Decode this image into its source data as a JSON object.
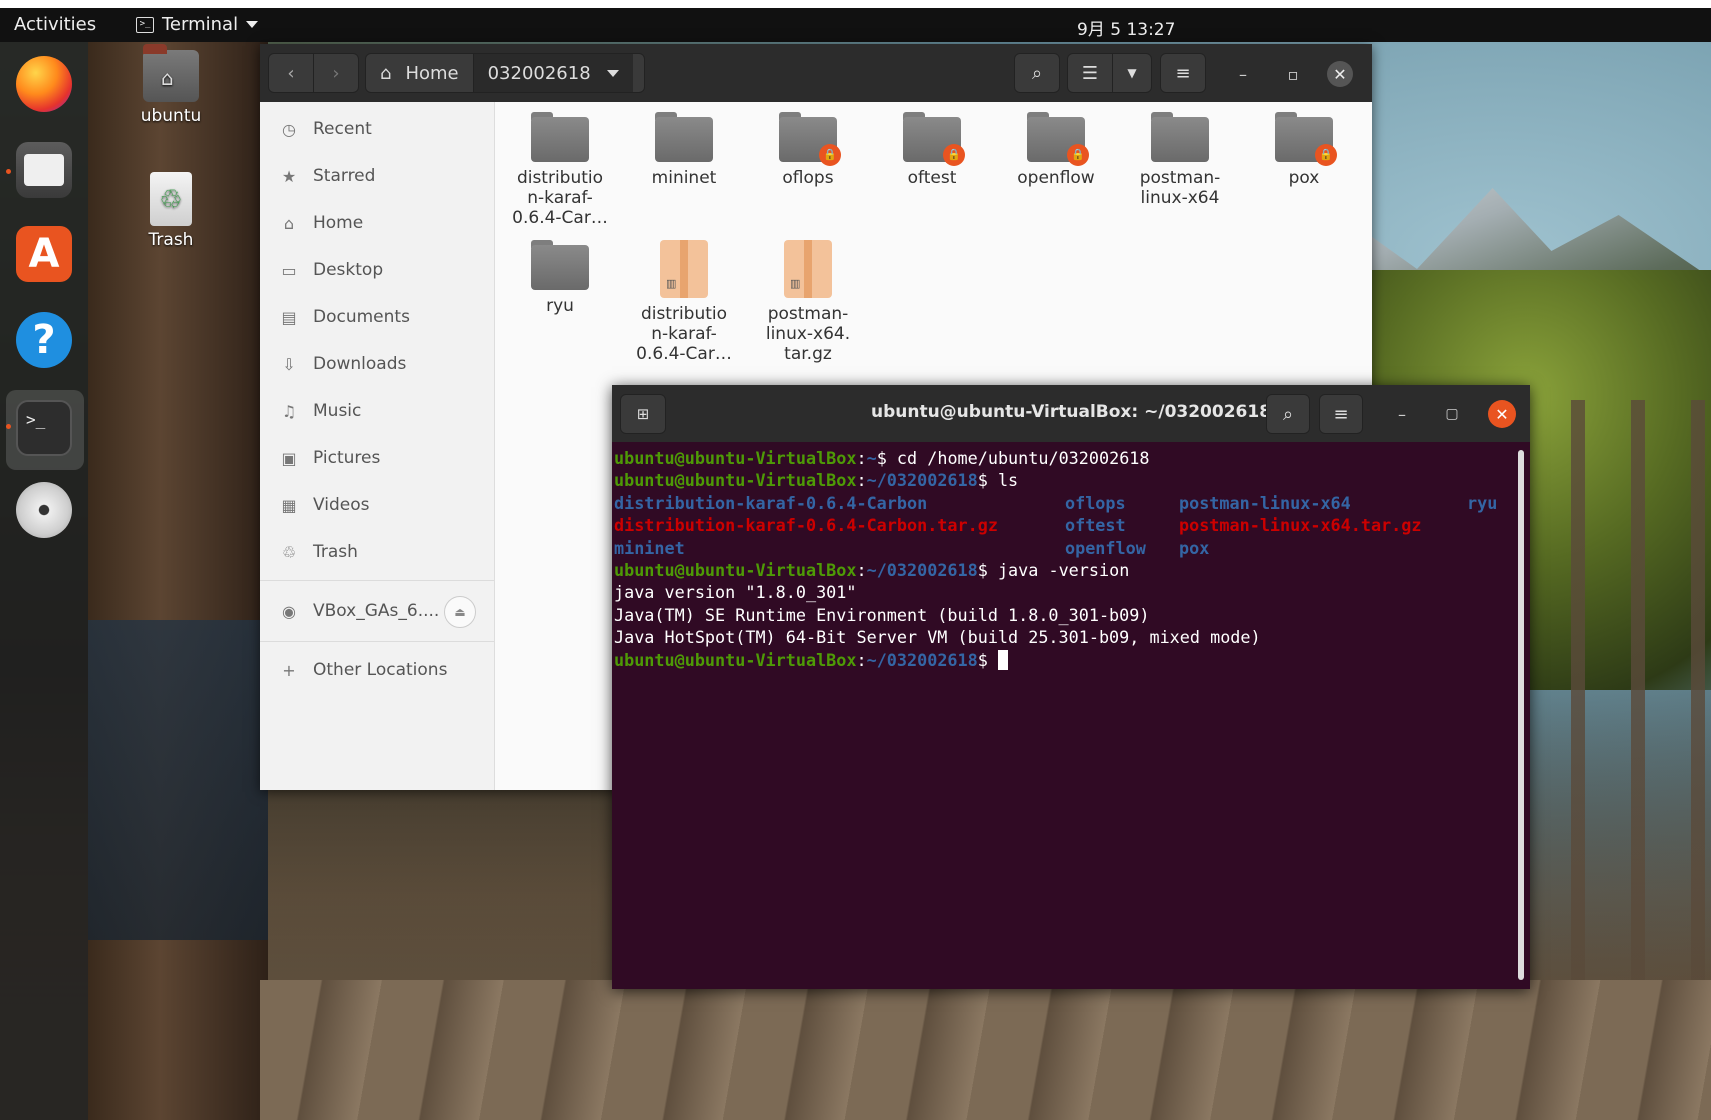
{
  "topbar": {
    "activities": "Activities",
    "app_menu": "Terminal",
    "clock": "9月 5 13:27"
  },
  "dock": {
    "items": [
      "firefox-icon",
      "files-icon",
      "software-icon",
      "help-icon",
      "terminal-icon",
      "disc-icon"
    ],
    "terminal_glyph": ">_",
    "software_glyph": "A",
    "help_glyph": "?"
  },
  "desktop": {
    "home_label": "ubuntu",
    "trash_label": "Trash"
  },
  "files": {
    "nav_back": "‹",
    "nav_forward": "›",
    "path": [
      "Home",
      "032002618"
    ],
    "sidebar": [
      {
        "icon": "clock-icon",
        "glyph": "◷",
        "label": "Recent"
      },
      {
        "icon": "star-icon",
        "glyph": "★",
        "label": "Starred"
      },
      {
        "icon": "home-icon",
        "glyph": "⌂",
        "label": "Home"
      },
      {
        "icon": "desktop-icon",
        "glyph": "▭",
        "label": "Desktop"
      },
      {
        "icon": "documents-icon",
        "glyph": "▤",
        "label": "Documents"
      },
      {
        "icon": "download-icon",
        "glyph": "⇩",
        "label": "Downloads"
      },
      {
        "icon": "music-icon",
        "glyph": "♫",
        "label": "Music"
      },
      {
        "icon": "pictures-icon",
        "glyph": "▣",
        "label": "Pictures"
      },
      {
        "icon": "videos-icon",
        "glyph": "▦",
        "label": "Videos"
      },
      {
        "icon": "trash-icon",
        "glyph": "♲",
        "label": "Trash"
      }
    ],
    "device": {
      "label": "VBox_GAs_6....",
      "glyph": "◉"
    },
    "other_locations": {
      "label": "Other Locations",
      "glyph": "+"
    },
    "items": [
      {
        "name": "distributio\nn-karaf-\n0.6.4-Car…",
        "kind": "folder",
        "locked": false
      },
      {
        "name": "mininet",
        "kind": "folder",
        "locked": false
      },
      {
        "name": "oflops",
        "kind": "folder",
        "locked": true
      },
      {
        "name": "oftest",
        "kind": "folder",
        "locked": true
      },
      {
        "name": "openflow",
        "kind": "folder",
        "locked": true
      },
      {
        "name": "postman-\nlinux-x64",
        "kind": "folder",
        "locked": false
      },
      {
        "name": "pox",
        "kind": "folder",
        "locked": true
      },
      {
        "name": "ryu",
        "kind": "folder",
        "locked": false
      },
      {
        "name": "distributio\nn-karaf-\n0.6.4-Car…",
        "kind": "archive",
        "locked": false
      },
      {
        "name": "postman-\nlinux-x64.\ntar.gz",
        "kind": "archive",
        "locked": false
      }
    ]
  },
  "terminal": {
    "title": "ubuntu@ubuntu-VirtualBox: ~/032002618",
    "prompt_user": "ubuntu@ubuntu-VirtualBox",
    "lines": [
      {
        "type": "cmd",
        "path": "~",
        "cmd": "cd /home/ubuntu/032002618"
      },
      {
        "type": "cmd",
        "path": "~/032002618",
        "cmd": "ls"
      },
      {
        "type": "ls",
        "cols": [
          {
            "text": "distribution-karaf-0.6.4-Carbon",
            "color": "b"
          },
          {
            "text": "oflops",
            "color": "b"
          },
          {
            "text": "postman-linux-x64",
            "color": "b"
          },
          {
            "text": "ryu",
            "color": "b"
          }
        ]
      },
      {
        "type": "ls",
        "cols": [
          {
            "text": "distribution-karaf-0.6.4-Carbon.tar.gz",
            "color": "r"
          },
          {
            "text": "oftest",
            "color": "b"
          },
          {
            "text": "postman-linux-x64.tar.gz",
            "color": "r"
          }
        ]
      },
      {
        "type": "ls",
        "cols": [
          {
            "text": "mininet",
            "color": "b"
          },
          {
            "text": "openflow",
            "color": "b"
          },
          {
            "text": "pox",
            "color": "b"
          }
        ]
      },
      {
        "type": "cmd",
        "path": "~/032002618",
        "cmd": "java -version"
      },
      {
        "type": "out",
        "text": "java version \"1.8.0_301\""
      },
      {
        "type": "out",
        "text": "Java(TM) SE Runtime Environment (build 1.8.0_301-b09)"
      },
      {
        "type": "out",
        "text": "Java HotSpot(TM) 64-Bit Server VM (build 25.301-b09, mixed mode)"
      },
      {
        "type": "prompt",
        "path": "~/032002618"
      }
    ]
  }
}
